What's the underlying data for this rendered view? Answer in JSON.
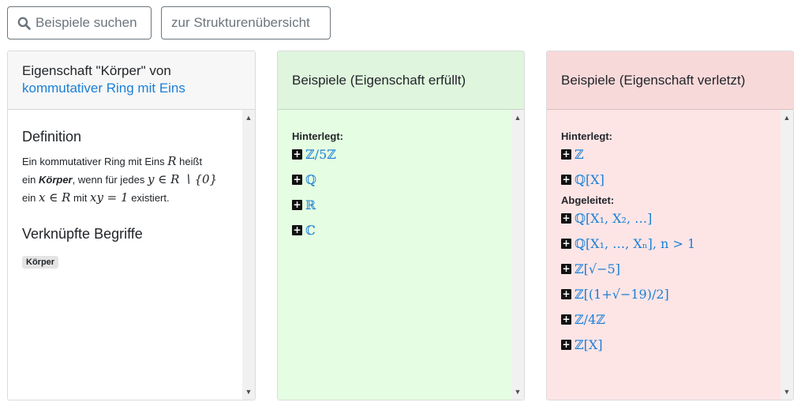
{
  "toolbar": {
    "search_label": "Beispiele suchen",
    "structure_label": "zur Strukturenübersicht"
  },
  "property_card": {
    "title_prefix": "Eigenschaft \"Körper\" von",
    "title_link": "kommutativer Ring mit Eins",
    "definition_heading": "Definition",
    "def_t1": "Ein kommutativer Ring mit Eins",
    "def_m1": "R",
    "def_t2": "heißt",
    "def_t3": "ein",
    "def_term": "Körper",
    "def_t4": ", wenn für jedes",
    "def_m2": "y ∈ R ∖ {0}",
    "def_t5": "ein",
    "def_m3": "x ∈ R",
    "def_t6": "mit",
    "def_m4": "xy = 1",
    "def_t7": "existiert.",
    "related_heading": "Verknüpfte Begriffe",
    "related_badge": "Körper"
  },
  "satisfied_card": {
    "title": "Beispiele (Eigenschaft erfüllt)",
    "stored_label": "Hinterlegt:",
    "stored": [
      "ℤ/5ℤ",
      "ℚ",
      "ℝ",
      "ℂ"
    ]
  },
  "violated_card": {
    "title": "Beispiele (Eigenschaft verletzt)",
    "stored_label": "Hinterlegt:",
    "stored": [
      "ℤ",
      "ℚ[X]"
    ],
    "derived_label": "Abgeleitet:",
    "derived": [
      "ℚ[X₁, X₂, …]",
      "ℚ[X₁, …, Xₙ], n > 1",
      "ℤ[√−5]",
      "ℤ[(1+√−19)/2]",
      "ℤ/4ℤ",
      "ℤ[X]"
    ]
  }
}
